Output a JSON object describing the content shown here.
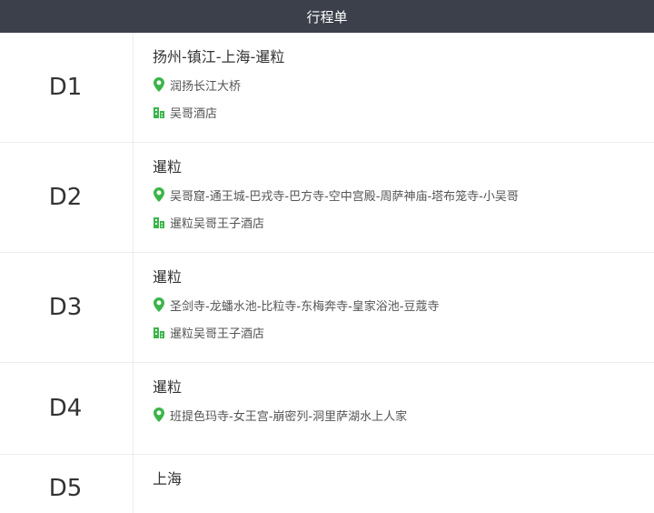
{
  "header": {
    "title": "行程单"
  },
  "days": [
    {
      "label": "D1",
      "route": "扬州-镇江-上海-暹粒",
      "places": "润扬长江大桥",
      "hotel": "吴哥酒店"
    },
    {
      "label": "D2",
      "route": "暹粒",
      "places": "吴哥窟-通王城-巴戎寺-巴方寺-空中宫殿-周萨神庙-塔布笼寺-小吴哥",
      "hotel": "暹粒吴哥王子酒店"
    },
    {
      "label": "D3",
      "route": "暹粒",
      "places": "圣剑寺-龙蟠水池-比粒寺-东梅奔寺-皇家浴池-豆蔻寺",
      "hotel": "暹粒吴哥王子酒店"
    },
    {
      "label": "D4",
      "route": "暹粒",
      "places": "班提色玛寺-女王宫-崩密列-洞里萨湖水上人家"
    },
    {
      "label": "D5",
      "route": "上海"
    }
  ],
  "colors": {
    "header_bg": "#3b404a",
    "icon_green": "#3bb54a"
  },
  "icons": {
    "places": "location-pin-icon",
    "hotel": "building-icon"
  }
}
